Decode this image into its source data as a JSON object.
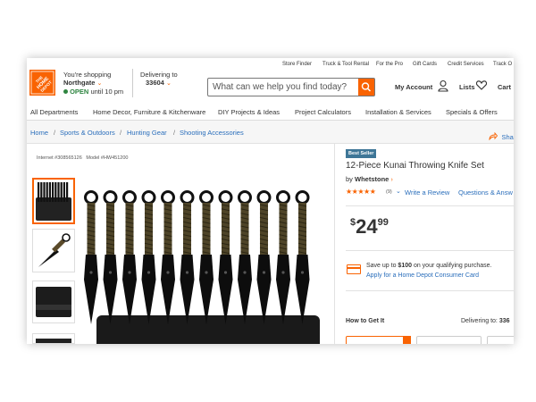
{
  "utility_nav": [
    "Store Finder",
    "Truck & Tool Rental",
    "For the Pro",
    "Gift Cards",
    "Credit Services",
    "Track O"
  ],
  "store": {
    "label": "You're shopping",
    "name": "Northgate",
    "status": "OPEN",
    "hours": "until 10 pm"
  },
  "delivery": {
    "label": "Delivering to",
    "zip": "33604"
  },
  "search": {
    "placeholder": "What can we help you find today?"
  },
  "account": {
    "my_account": "My Account",
    "lists": "Lists",
    "cart": "Cart"
  },
  "main_nav": [
    "All Departments",
    "Home Decor, Furniture & Kitchenware",
    "DIY Projects & Ideas",
    "Project Calculators",
    "Installation & Services",
    "Specials & Offers"
  ],
  "breadcrumb": [
    "Home",
    "Sports & Outdoors",
    "Hunting Gear",
    "Shooting Accessories"
  ],
  "share_label": "Sha",
  "product": {
    "internet_no": "Internet #308565126",
    "model_no": "Model #HW451200",
    "badge": "Best Seller",
    "title": "12-Piece Kunai Throwing Knife Set",
    "by": "by",
    "brand": "Whetstone",
    "rating": 4.5,
    "stars": "★★★★★",
    "review_count": "(9)",
    "write_review": "Write a Review",
    "questions": "Questions & Answ",
    "price": {
      "symbol": "$",
      "dollars": "24",
      "cents": "99"
    }
  },
  "credit_offer": {
    "text_pre": "Save up to ",
    "amount": "$100",
    "text_post": " on your qualifying purchase.",
    "link": "Apply for a Home Depot Consumer Card"
  },
  "fulfillment": {
    "heading": "How to Get It",
    "delivering_to": "Delivering to:",
    "zip": "336"
  },
  "colors": {
    "brand": "#f96302",
    "link": "#2a6ebb",
    "badge": "#3e7697"
  },
  "icons": [
    "home-depot-logo",
    "chevron-down-icon",
    "search-icon",
    "user-icon",
    "heart-icon",
    "share-icon",
    "credit-card-icon",
    "star-icon"
  ]
}
